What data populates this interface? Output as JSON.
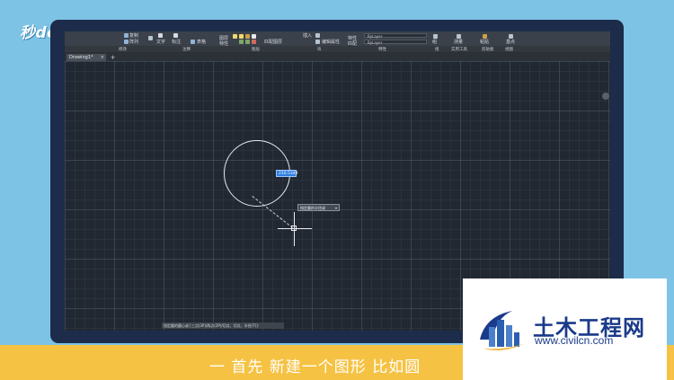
{
  "logo": {
    "text": "秒dong视频"
  },
  "ribbon": {
    "panels": [
      "修改",
      "注释",
      "图层",
      "块",
      "特性",
      "组",
      "实用工具",
      "剪贴板",
      "视图"
    ],
    "items": {
      "copy": "复制",
      "array": "阵列",
      "text": "文字",
      "dimension": "标注",
      "table": "表格",
      "layer_properties": "图层特性",
      "match_layer": "匹配图层",
      "insert": "插入",
      "edit_attributes": "编辑属性",
      "match_properties": "特性匹配",
      "bylayer_1": "ByLayer",
      "bylayer_2": "ByLayer",
      "group": "组",
      "measure": "测量",
      "paste": "粘贴",
      "base": "基点"
    }
  },
  "tabs": {
    "document": "Drawing1*",
    "close_glyph": "×",
    "add_glyph": "+"
  },
  "drawing": {
    "dynamic_input_value": "210.5349",
    "tooltip": "指定圆的半径或",
    "tooltip_arrow": "▾"
  },
  "command_line": {
    "text": "指定圆的圆心或 [三点(3P)/两点(2P)/切点、切点、半径(T)]:"
  },
  "caption": {
    "text": "一 首先 新建一个图形 比如圆"
  },
  "watermark": {
    "title": "土木工程网",
    "url": "www.civilcn.com"
  },
  "colors": {
    "background": "#7cc3e6",
    "monitor": "#1d2c4a",
    "canvas": "#212832",
    "caption_bar": "#f5c243",
    "selection": "#2f7ee0",
    "watermark_text": "#1a3a8a"
  }
}
